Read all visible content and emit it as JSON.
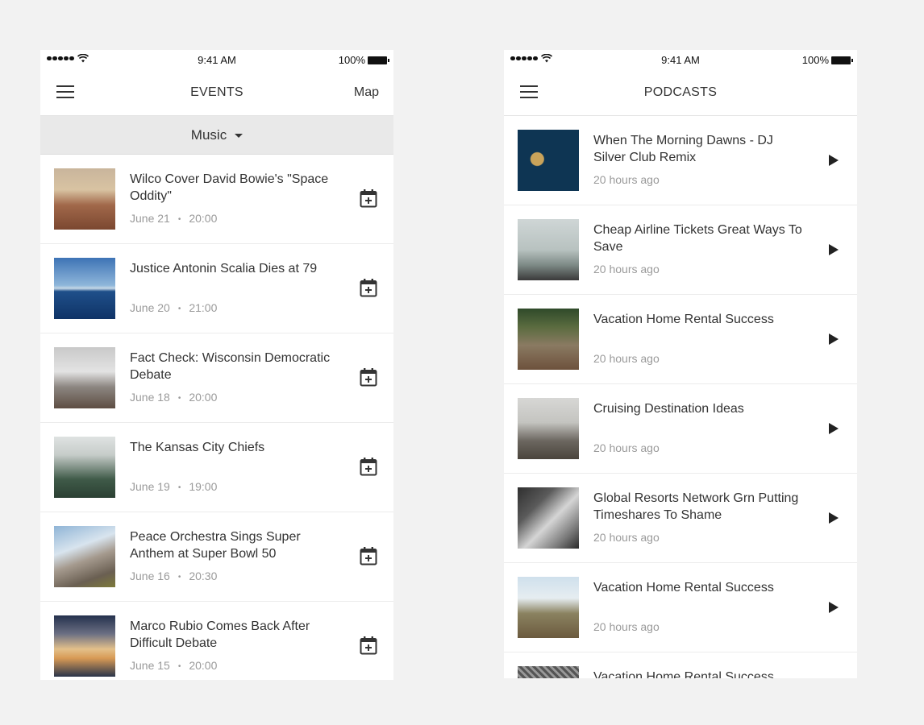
{
  "events_screen": {
    "status": {
      "time": "9:41 AM",
      "battery": "100%"
    },
    "title": "EVENTS",
    "map_label": "Map",
    "filter": "Music",
    "items": [
      {
        "title": "Wilco Cover David Bowie's \"Space Oddity\"",
        "date": "June 21",
        "time": "20:00"
      },
      {
        "title": "Justice Antonin Scalia Dies at 79",
        "date": "June 20",
        "time": "21:00"
      },
      {
        "title": "Fact Check: Wisconsin Democratic Debate",
        "date": "June 18",
        "time": "20:00"
      },
      {
        "title": "The Kansas City Chiefs",
        "date": "June 19",
        "time": "19:00"
      },
      {
        "title": "Peace Orchestra Sings Super Anthem at Super Bowl 50",
        "date": "June 16",
        "time": "20:30"
      },
      {
        "title": "Marco Rubio Comes Back After Difficult Debate",
        "date": "June 15",
        "time": "20:00"
      }
    ]
  },
  "podcasts_screen": {
    "status": {
      "time": "9:41 AM",
      "battery": "100%"
    },
    "title": "PODCASTS",
    "items": [
      {
        "title": "When The Morning Dawns - DJ Silver Club Remix",
        "age": "20 hours ago"
      },
      {
        "title": "Cheap Airline Tickets Great Ways To Save",
        "age": "20 hours ago"
      },
      {
        "title": "Vacation Home Rental Success",
        "age": "20 hours ago"
      },
      {
        "title": "Cruising Destination Ideas",
        "age": "20 hours ago"
      },
      {
        "title": "Global Resorts Network Grn Putting Timeshares To Shame",
        "age": "20 hours ago"
      },
      {
        "title": "Vacation Home Rental Success",
        "age": "20 hours ago"
      },
      {
        "title": "Vacation Home Rental Success",
        "age": ""
      }
    ]
  },
  "icons": {
    "menu": "hamburger-menu-icon",
    "calendar": "calendar-add-icon",
    "play": "play-icon",
    "caret": "caret-down-icon",
    "wifi": "wifi-icon",
    "battery": "battery-icon",
    "signal": "signal-dots-icon"
  },
  "colors": {
    "background": "#f2f2f2",
    "card": "#ffffff",
    "filter_bar": "#e9e9e9",
    "text": "#333333",
    "meta": "#9a9a9a"
  }
}
